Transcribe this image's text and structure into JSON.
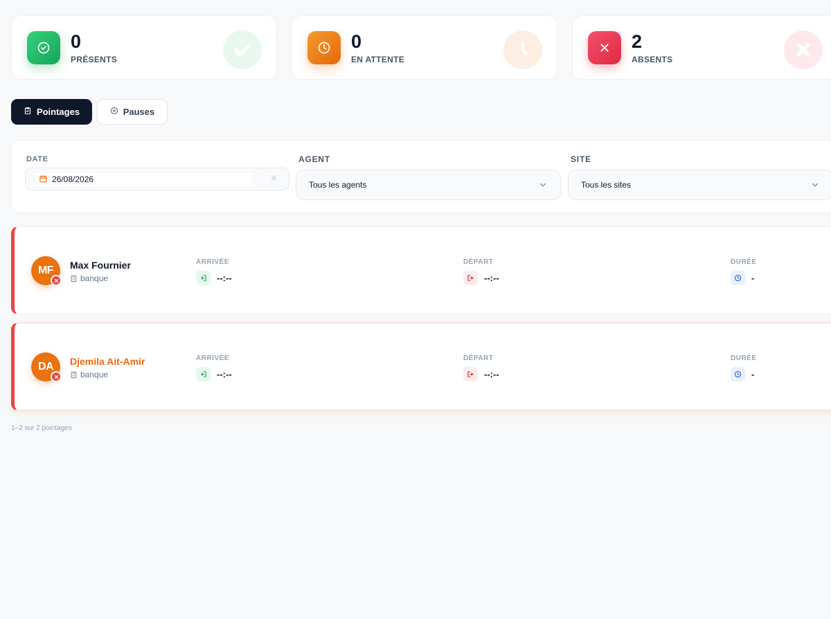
{
  "stats": [
    {
      "value": "0",
      "label": "PRÉSENTS",
      "icon": "check-circle-icon",
      "color": "#16a34a"
    },
    {
      "value": "0",
      "label": "EN ATTENTE",
      "icon": "clock-icon",
      "color": "#ea6c0c"
    },
    {
      "value": "2",
      "label": "ABSENTS",
      "icon": "x-icon",
      "color": "#e11d48"
    }
  ],
  "tabs": {
    "pointages": "Pointages",
    "pauses": "Pauses"
  },
  "filters": {
    "date_label": "DATE",
    "date_value": "26/08/2026",
    "agent_label": "AGENT",
    "agent_value": "Tous les agents",
    "site_label": "SITE",
    "site_value": "Tous les sites"
  },
  "columns": {
    "arrival": "ARRIVÉE",
    "departure": "DÉPART",
    "duration": "DURÉE"
  },
  "records": [
    {
      "initials": "MF",
      "name": "Max Fournier",
      "site": "banque",
      "arrival": "--:--",
      "departure": "--:--",
      "duration": "-"
    },
    {
      "initials": "DA",
      "name": "Djemila Ait-Amir",
      "site": "banque",
      "arrival": "--:--",
      "departure": "--:--",
      "duration": "-"
    }
  ],
  "footer": {
    "count_text": "1–2 sur 2 pointages"
  }
}
